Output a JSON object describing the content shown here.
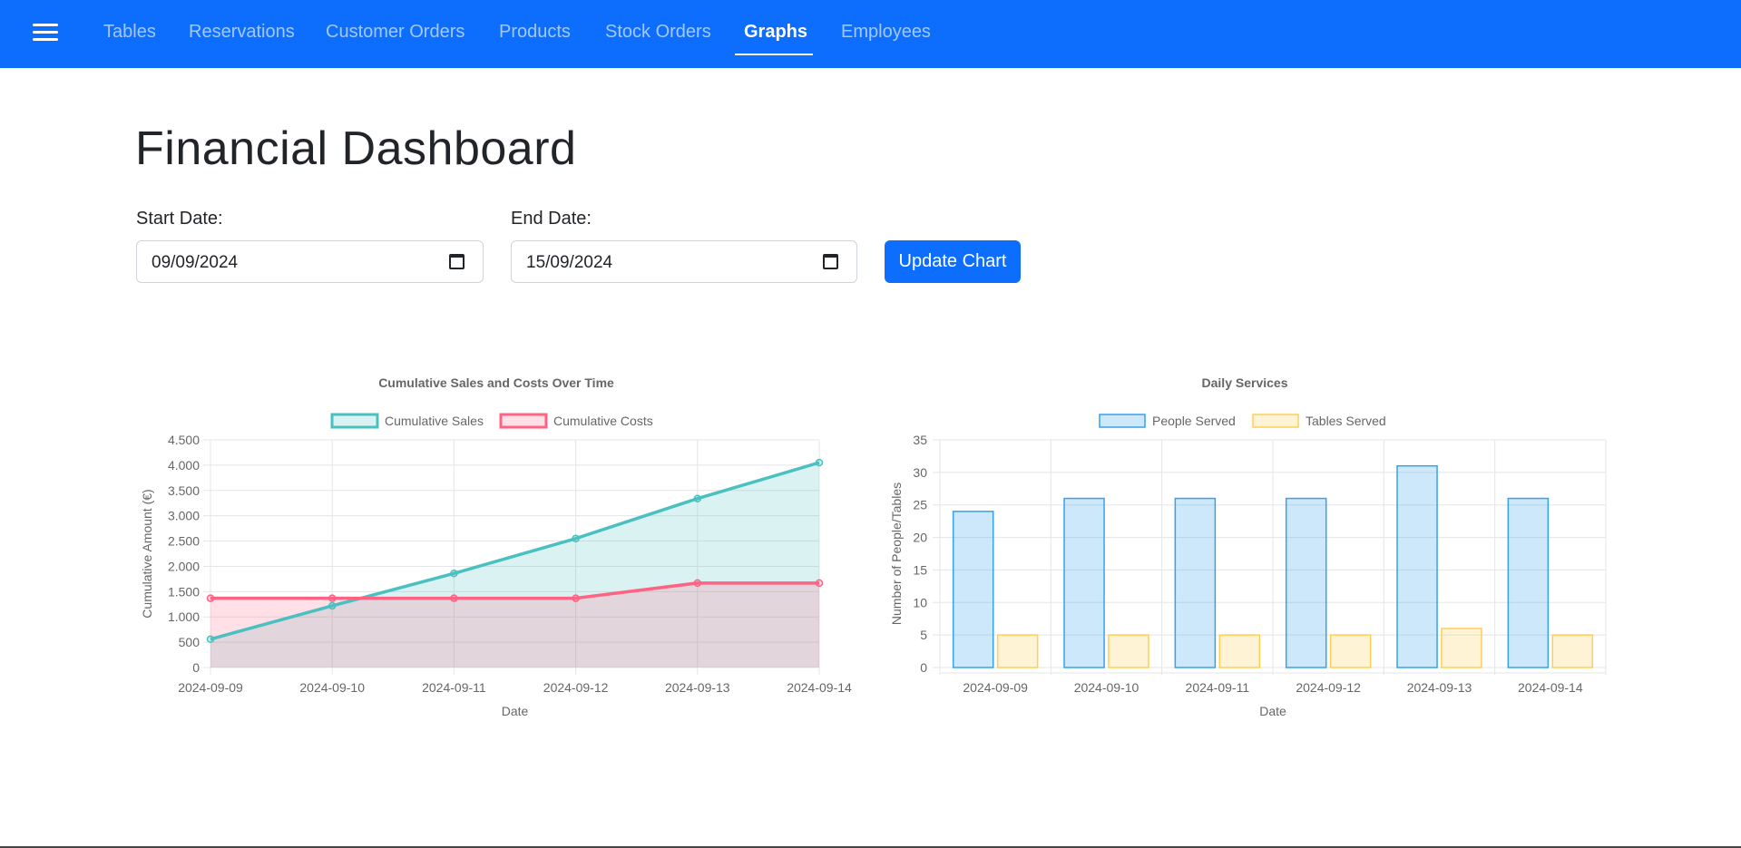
{
  "nav": {
    "items": [
      {
        "label": "Tables",
        "active": false
      },
      {
        "label": "Reservations",
        "active": false
      },
      {
        "label": "Customer Orders",
        "active": false
      },
      {
        "label": "Products",
        "active": false
      },
      {
        "label": "Stock Orders",
        "active": false
      },
      {
        "label": "Graphs",
        "active": true
      },
      {
        "label": "Employees",
        "active": false
      }
    ]
  },
  "page": {
    "title": "Financial Dashboard",
    "start_label": "Start Date:",
    "start_value": "09/09/2024",
    "end_label": "End Date:",
    "end_value": "15/09/2024",
    "update_label": "Update Chart"
  },
  "colors": {
    "navbar": "#0d6efd",
    "sales": "#4bc0c0",
    "costs": "#ff6384",
    "people": "#36a2eb",
    "tables": "#ffce56"
  },
  "chart_data": [
    {
      "type": "line",
      "title": "Cumulative Sales and Costs Over Time",
      "xlabel": "Date",
      "ylabel": "Cumulative Amount (€)",
      "ylim": [
        0,
        4500
      ],
      "yticks": [
        "0",
        "500",
        "1.000",
        "1.500",
        "2.000",
        "2.500",
        "3.000",
        "3.500",
        "4.000",
        "4.500"
      ],
      "legend": "top",
      "grid": true,
      "categories": [
        "2024-09-09",
        "2024-09-10",
        "2024-09-11",
        "2024-09-12",
        "2024-09-13",
        "2024-09-14"
      ],
      "series": [
        {
          "name": "Cumulative Sales",
          "values": [
            560,
            1220,
            1860,
            2550,
            3340,
            4050
          ]
        },
        {
          "name": "Cumulative Costs",
          "values": [
            1370,
            1370,
            1370,
            1370,
            1670,
            1670
          ]
        }
      ]
    },
    {
      "type": "bar",
      "title": "Daily Services",
      "xlabel": "Date",
      "ylabel": "Number of People/Tables",
      "ylim": [
        0,
        35
      ],
      "yticks": [
        "0",
        "5",
        "10",
        "15",
        "20",
        "25",
        "30",
        "35"
      ],
      "legend": "top",
      "grid": true,
      "categories": [
        "2024-09-09",
        "2024-09-10",
        "2024-09-11",
        "2024-09-12",
        "2024-09-13",
        "2024-09-14"
      ],
      "series": [
        {
          "name": "People Served",
          "values": [
            24,
            26,
            26,
            26,
            31,
            26
          ]
        },
        {
          "name": "Tables Served",
          "values": [
            5,
            5,
            5,
            5,
            6,
            5
          ]
        }
      ]
    }
  ]
}
